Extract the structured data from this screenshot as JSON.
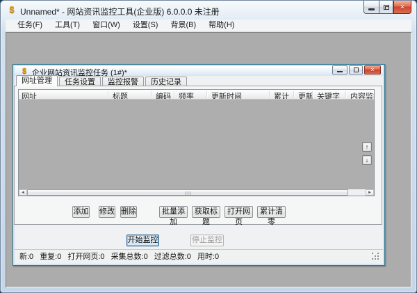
{
  "window": {
    "title": "Unnamed* - 网站资讯监控工具(企业版) 6.0.0.0 未注册",
    "app_icon_glyph": "$"
  },
  "menu": {
    "items": [
      {
        "label": "任务(F)"
      },
      {
        "label": "工具(T)"
      },
      {
        "label": "窗口(W)"
      },
      {
        "label": "设置(S)"
      },
      {
        "label": "背景(B)"
      },
      {
        "label": "帮助(H)"
      }
    ]
  },
  "child_window": {
    "title": "企业网站资讯监控任务  (1#)*",
    "tabs": [
      {
        "label": "网址管理",
        "active": true
      },
      {
        "label": "任务设置",
        "active": false
      },
      {
        "label": "监控报警",
        "active": false
      },
      {
        "label": "历史记录",
        "active": false
      }
    ],
    "table": {
      "columns": [
        "网址",
        "标题",
        "编码",
        "频率",
        "更新时间",
        "累计",
        "更新",
        "关键字",
        "内容监控"
      ],
      "rows": []
    },
    "row_buttons": {
      "add": "添加",
      "modify": "修改",
      "delete": "删除",
      "batch_add": "批量添加",
      "get_title": "获取标题",
      "open_page": "打开网页",
      "reset_total": "累计清零"
    },
    "control_buttons": {
      "start": "开始监控",
      "stop": "停止监控"
    },
    "status": {
      "items": [
        {
          "label": "新",
          "value": "0"
        },
        {
          "label": "重复",
          "value": "0"
        },
        {
          "label": "打开网页",
          "value": "0"
        },
        {
          "label": "采集总数",
          "value": "0"
        },
        {
          "label": "过滤总数",
          "value": "0"
        },
        {
          "label": "用时",
          "value": "0"
        }
      ]
    }
  },
  "colors": {
    "mdi_background": "#acacac",
    "close_button_red": "#ce4530",
    "app_icon_gold": "#e3a41c",
    "child_border_teal": "#30758f"
  }
}
